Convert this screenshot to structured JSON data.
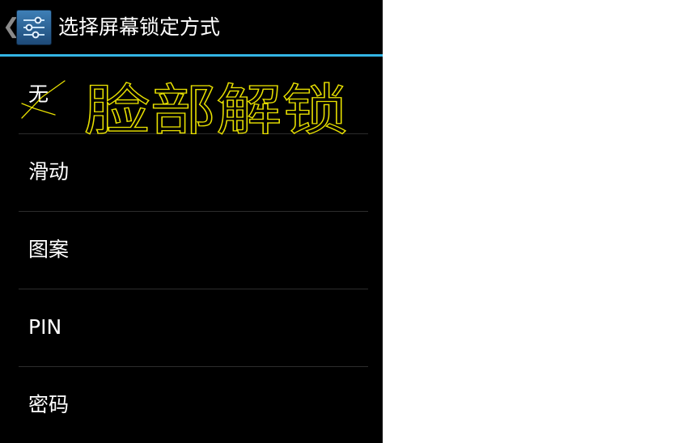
{
  "action_bar": {
    "title": "选择屏幕锁定方式",
    "up_icon": "chevron-left-icon",
    "app_icon": "settings-sliders-icon"
  },
  "lock_options": [
    {
      "label": "无"
    },
    {
      "label": "滑动"
    },
    {
      "label": "图案"
    },
    {
      "label": "PIN"
    },
    {
      "label": "密码"
    }
  ],
  "annotation": {
    "text": "脸部解锁",
    "style": "handwritten",
    "color": "#e8e000"
  },
  "colors": {
    "background": "#000000",
    "accent_divider": "#33b5e5",
    "text": "#ffffff"
  }
}
